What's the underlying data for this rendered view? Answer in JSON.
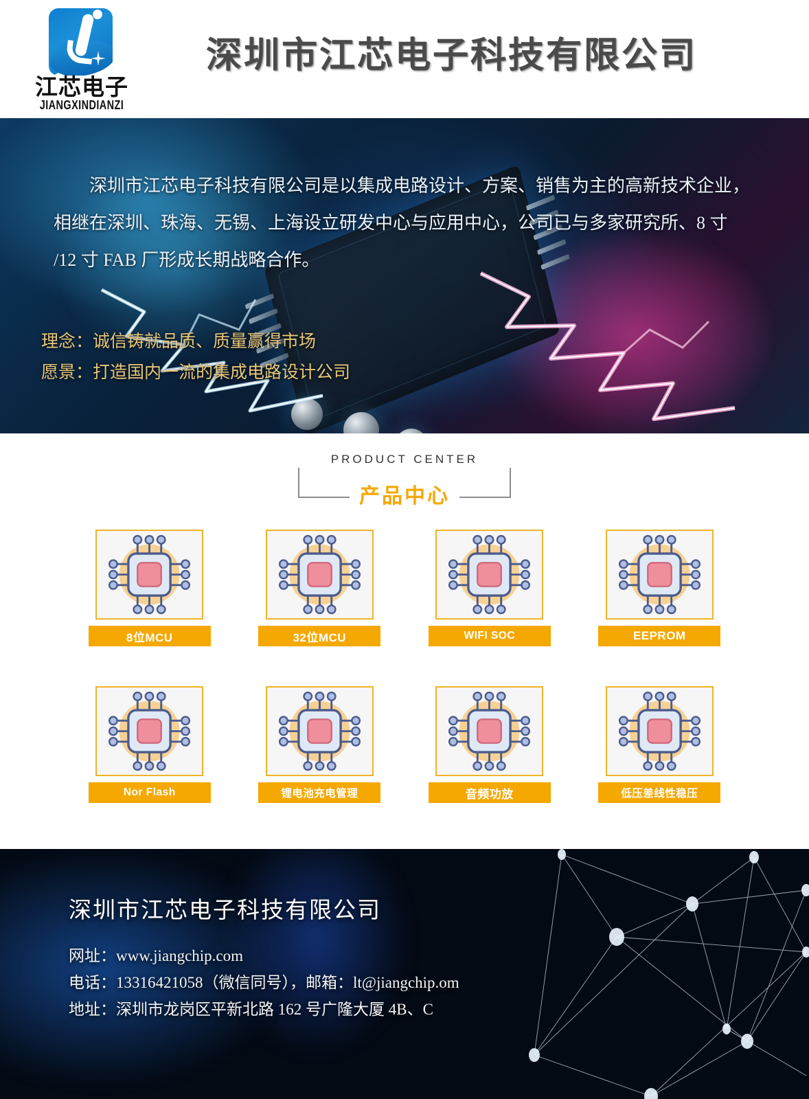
{
  "header": {
    "logo": {
      "cn": "江芯电子",
      "en": "JIANGXINDIANZI",
      "mark_name": "jiangxin-j-swoosh-logo"
    },
    "title": "深圳市江芯电子科技有限公司"
  },
  "hero": {
    "intro": "深圳市江芯电子科技有限公司是以集成电路设计、方案、销售为主的高新技术企业，相继在深圳、珠海、无锡、上海设立研发中心与应用中心，公司已与多家研究所、8 寸 /12 寸 FAB 厂形成长期战略合作。",
    "slogan_1": "理念：诚信铸就品质、质量赢得市场",
    "slogan_2": "愿景：打造国内一流的集成电路设计公司",
    "accent_color": "#e8c77a"
  },
  "products": {
    "section_title_en": "PRODUCT CENTER",
    "section_title_cn": "产品中心",
    "accent_color": "#f5a800",
    "border_color": "#f0b429",
    "items": [
      {
        "label": "8位MCU",
        "icon": "chip-icon"
      },
      {
        "label": "32位MCU",
        "icon": "chip-icon"
      },
      {
        "label": "WIFI SOC",
        "icon": "chip-icon"
      },
      {
        "label": "EEPROM",
        "icon": "chip-icon"
      },
      {
        "label": "Nor Flash",
        "icon": "chip-icon"
      },
      {
        "label": "锂电池充电管理",
        "icon": "chip-icon"
      },
      {
        "label": "音频功放",
        "icon": "chip-icon"
      },
      {
        "label": "低压差线性稳压",
        "icon": "chip-icon"
      }
    ]
  },
  "footer": {
    "company": "深圳市江芯电子科技有限公司",
    "website_line": "网址：www.jiangchip.com",
    "contact_line": "电话：13316421058（微信同号），邮箱：lt@jiangchip.om",
    "address_line": "地址：深圳市龙岗区平新北路 162 号广隆大厦 4B、C"
  }
}
